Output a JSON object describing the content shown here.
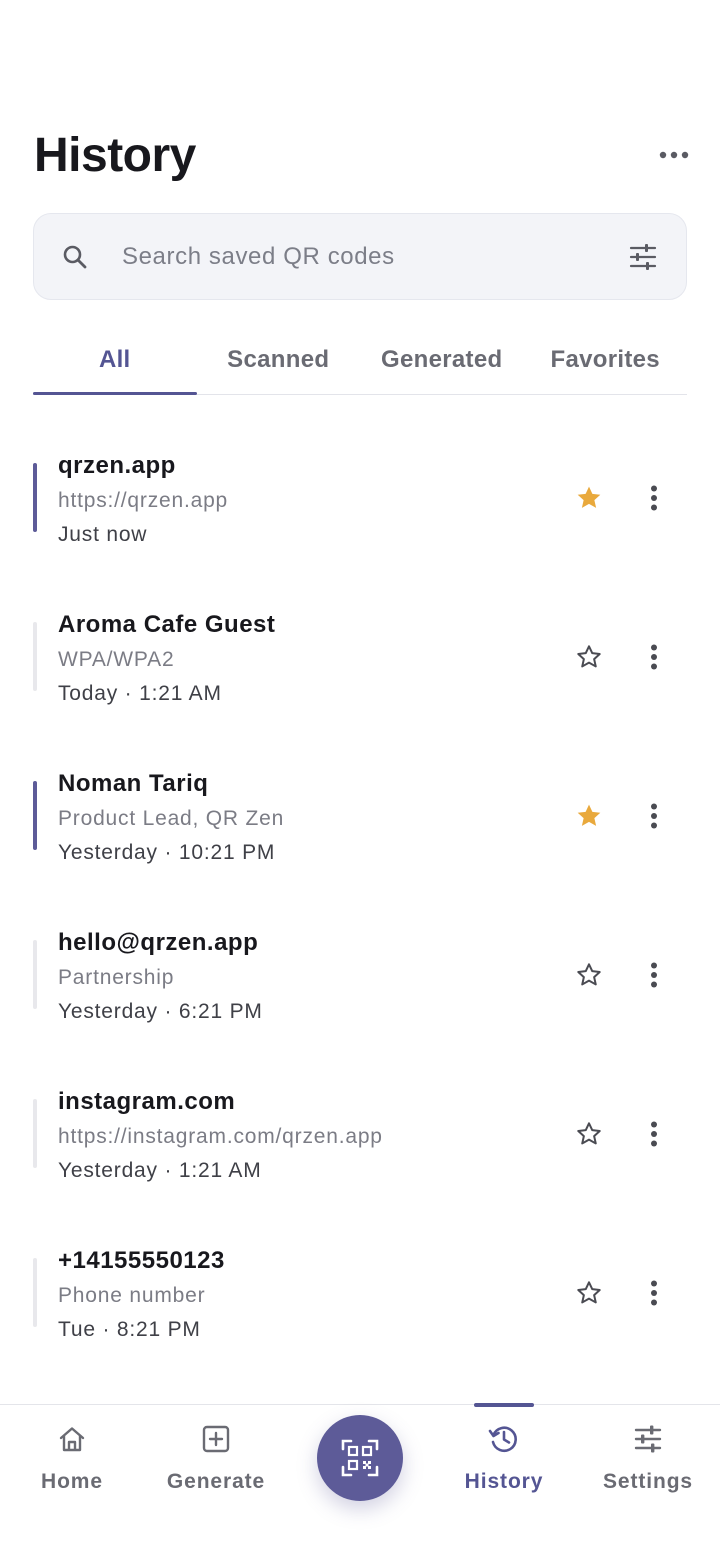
{
  "header": {
    "title": "History"
  },
  "search": {
    "placeholder": "Search saved QR codes"
  },
  "tabs": [
    {
      "label": "All",
      "active": true
    },
    {
      "label": "Scanned",
      "active": false
    },
    {
      "label": "Generated",
      "active": false
    },
    {
      "label": "Favorites",
      "active": false
    }
  ],
  "items": [
    {
      "title": "qrzen.app",
      "subtitle": "https://qrzen.app",
      "time": "Just now",
      "favorite": true
    },
    {
      "title": "Aroma Cafe Guest",
      "subtitle": "WPA/WPA2",
      "time": "Today · 1:21 AM",
      "favorite": false
    },
    {
      "title": "Noman Tariq",
      "subtitle": "Product Lead, QR Zen",
      "time": "Yesterday · 10:21 PM",
      "favorite": true
    },
    {
      "title": "hello@qrzen.app",
      "subtitle": "Partnership",
      "time": "Yesterday · 6:21 PM",
      "favorite": false
    },
    {
      "title": "instagram.com",
      "subtitle": "https://instagram.com/qrzen.app",
      "time": "Yesterday · 1:21 AM",
      "favorite": false
    },
    {
      "title": "+14155550123",
      "subtitle": "Phone number",
      "time": "Tue · 8:21 PM",
      "favorite": false
    }
  ],
  "nav": {
    "home": "Home",
    "generate": "Generate",
    "history": "History",
    "settings": "Settings"
  },
  "colors": {
    "accent": "#545593",
    "fab": "#5d5b98",
    "star_filled": "#e9a93c",
    "text_primary": "#18181d",
    "text_secondary": "#7b7c85"
  }
}
